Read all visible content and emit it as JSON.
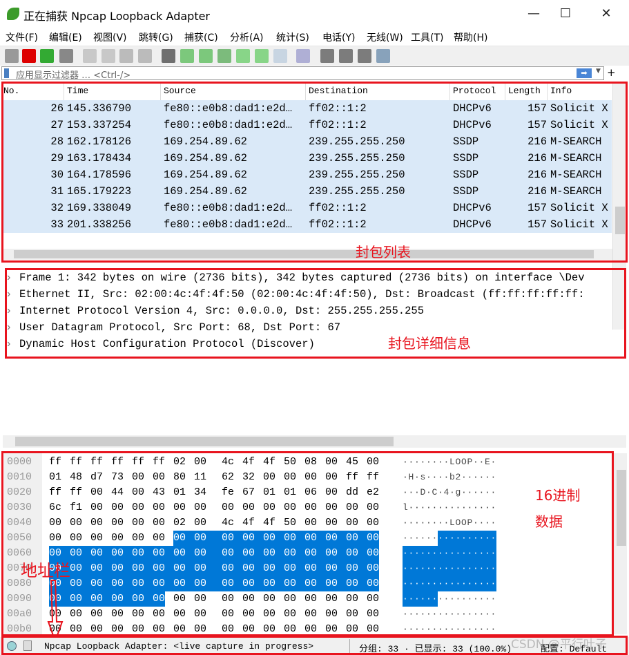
{
  "window": {
    "title": "正在捕获 Npcap Loopback Adapter",
    "minimize": "—",
    "maximize": "☐",
    "close": "✕"
  },
  "menu": [
    "文件(F)",
    "编辑(E)",
    "视图(V)",
    "跳转(G)",
    "捕获(C)",
    "分析(A)",
    "统计(S)",
    "电话(Y)",
    "无线(W)",
    "工具(T)",
    "帮助(H)"
  ],
  "toolbar": [
    "shark-fin-start",
    "stop-square",
    "restart",
    "options-gear",
    "open-file",
    "save-file",
    "close-file",
    "reload",
    "find",
    "go-back",
    "go-forward",
    "go-to-packet",
    "first-packet",
    "last-packet",
    "autoscroll",
    "colorize",
    "zoom-in",
    "zoom-out",
    "zoom-reset",
    "resize-columns"
  ],
  "filter": {
    "placeholder": "应用显示过滤器 … <Ctrl-/>",
    "add": "+"
  },
  "packet_list": {
    "columns": [
      "No.",
      "Time",
      "Source",
      "Destination",
      "Protocol",
      "Length",
      "Info"
    ],
    "rows": [
      [
        "26",
        "145.336790",
        "fe80::e0b8:dad1:e2d…",
        "ff02::1:2",
        "DHCPv6",
        "157",
        "Solicit X"
      ],
      [
        "27",
        "153.337254",
        "fe80::e0b8:dad1:e2d…",
        "ff02::1:2",
        "DHCPv6",
        "157",
        "Solicit X"
      ],
      [
        "28",
        "162.178126",
        "169.254.89.62",
        "239.255.255.250",
        "SSDP",
        "216",
        "M-SEARCH"
      ],
      [
        "29",
        "163.178434",
        "169.254.89.62",
        "239.255.255.250",
        "SSDP",
        "216",
        "M-SEARCH"
      ],
      [
        "30",
        "164.178596",
        "169.254.89.62",
        "239.255.255.250",
        "SSDP",
        "216",
        "M-SEARCH"
      ],
      [
        "31",
        "165.179223",
        "169.254.89.62",
        "239.255.255.250",
        "SSDP",
        "216",
        "M-SEARCH"
      ],
      [
        "32",
        "169.338049",
        "fe80::e0b8:dad1:e2d…",
        "ff02::1:2",
        "DHCPv6",
        "157",
        "Solicit X"
      ],
      [
        "33",
        "201.338256",
        "fe80::e0b8:dad1:e2d…",
        "ff02::1:2",
        "DHCPv6",
        "157",
        "Solicit X"
      ]
    ],
    "row_color": "#dae9f8"
  },
  "details": [
    "Frame 1: 342 bytes on wire (2736 bits), 342 bytes captured (2736 bits) on interface \\Dev",
    "Ethernet II, Src: 02:00:4c:4f:4f:50 (02:00:4c:4f:4f:50), Dst: Broadcast (ff:ff:ff:ff:ff:",
    "Internet Protocol Version 4, Src: 0.0.0.0, Dst: 255.255.255.255",
    "User Datagram Protocol, Src Port: 68, Dst Port: 67",
    "Dynamic Host Configuration Protocol (Discover)"
  ],
  "hex": {
    "selection_bytes": [
      86,
      149
    ],
    "selection_color": "#0078d7",
    "rows": [
      {
        "offset": "0000",
        "bytes": "ff ff ff ff ff ff 02 00 4c 4f 4f 50 08 00 45 00",
        "ascii": "········LOOP··E·"
      },
      {
        "offset": "0010",
        "bytes": "01 48 d7 73 00 00 80 11 62 32 00 00 00 00 ff ff",
        "ascii": "·H·s····b2······"
      },
      {
        "offset": "0020",
        "bytes": "ff ff 00 44 00 43 01 34 fe 67 01 01 06 00 dd e2",
        "ascii": "···D·C·4·g······"
      },
      {
        "offset": "0030",
        "bytes": "6c f1 00 00 00 00 00 00 00 00 00 00 00 00 00 00",
        "ascii": "l···············"
      },
      {
        "offset": "0040",
        "bytes": "00 00 00 00 00 00 02 00 4c 4f 4f 50 00 00 00 00",
        "ascii": "········LOOP····"
      },
      {
        "offset": "0050",
        "bytes": "00 00 00 00 00 00 00 00 00 00 00 00 00 00 00 00",
        "ascii": "················"
      },
      {
        "offset": "0060",
        "bytes": "00 00 00 00 00 00 00 00 00 00 00 00 00 00 00 00",
        "ascii": "················"
      },
      {
        "offset": "0070",
        "bytes": "00 00 00 00 00 00 00 00 00 00 00 00 00 00 00 00",
        "ascii": "················"
      },
      {
        "offset": "0080",
        "bytes": "00 00 00 00 00 00 00 00 00 00 00 00 00 00 00 00",
        "ascii": "················"
      },
      {
        "offset": "0090",
        "bytes": "00 00 00 00 00 00 00 00 00 00 00 00 00 00 00 00",
        "ascii": "················"
      },
      {
        "offset": "00a0",
        "bytes": "00 00 00 00 00 00 00 00 00 00 00 00 00 00 00 00",
        "ascii": "················"
      },
      {
        "offset": "00b0",
        "bytes": "00 00 00 00 00 00 00 00 00 00 00 00 00 00 00 00",
        "ascii": "················"
      }
    ]
  },
  "status": {
    "interface": "Npcap Loopback Adapter: <live capture in progress>",
    "packets": "分组: 33 · 已显示: 33 (100.0%)",
    "profile": "配置: Default"
  },
  "annotations": {
    "list": "封包列表",
    "details": "封包详细信息",
    "hex1": "16进制",
    "hex2": "数据",
    "address": "地址栏",
    "watermark": "CSDN @平行叶子"
  },
  "colors": {
    "annotation": "#e8141e"
  }
}
